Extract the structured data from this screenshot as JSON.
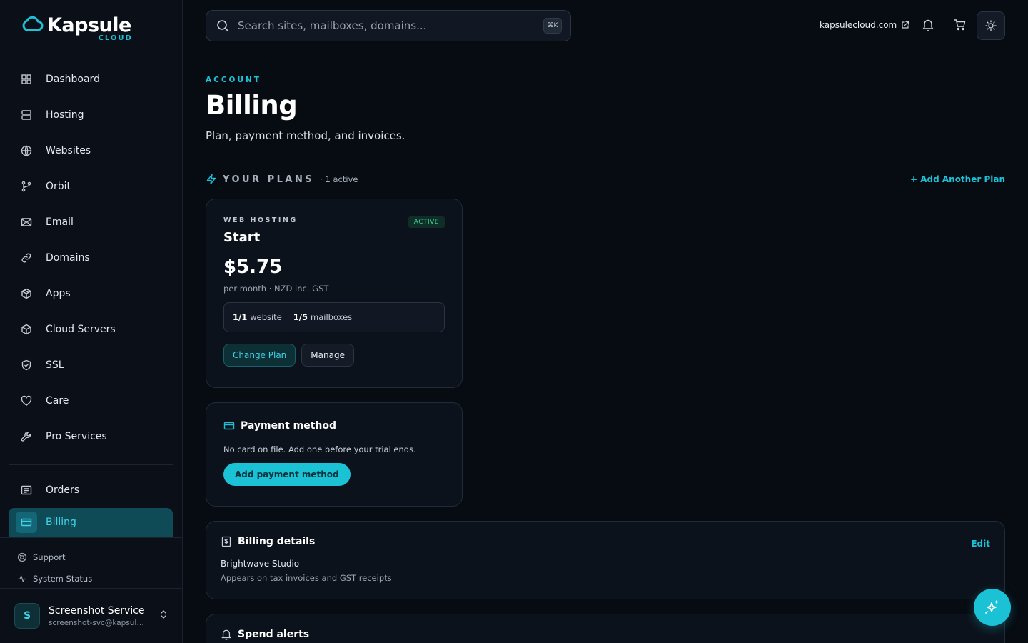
{
  "brand": {
    "name": "Kapsule",
    "sub": "CLOUD",
    "accent": "#1cc2d8"
  },
  "sidebar": {
    "items": [
      {
        "label": "Dashboard",
        "icon": "grid-icon"
      },
      {
        "label": "Hosting",
        "icon": "server-icon"
      },
      {
        "label": "Websites",
        "icon": "globe-icon"
      },
      {
        "label": "Orbit",
        "icon": "git-branch-icon"
      },
      {
        "label": "Email",
        "icon": "mail-icon"
      },
      {
        "label": "Domains",
        "icon": "link-icon"
      },
      {
        "label": "Apps",
        "icon": "package-icon"
      },
      {
        "label": "Cloud Servers",
        "icon": "cube-icon"
      },
      {
        "label": "SSL",
        "icon": "shield-icon"
      },
      {
        "label": "Care",
        "icon": "heart-icon"
      },
      {
        "label": "Pro Services",
        "icon": "wrench-icon"
      }
    ],
    "secondary": [
      {
        "label": "Orders",
        "icon": "receipt-icon"
      },
      {
        "label": "Billing",
        "icon": "credit-card-icon",
        "active": true
      }
    ],
    "footer_links": [
      {
        "label": "Support",
        "icon": "lifebuoy-icon"
      },
      {
        "label": "System Status",
        "icon": "activity-icon"
      }
    ],
    "user": {
      "initial": "S",
      "name": "Screenshot Service",
      "email": "screenshot-svc@kapsulecl..."
    }
  },
  "topbar": {
    "search_placeholder": "Search sites, mailboxes, domains...",
    "shortcut": "⌘K",
    "site_link": "kapsulecloud.com"
  },
  "page": {
    "eyebrow": "ACCOUNT",
    "title": "Billing",
    "subtitle": "Plan, payment method, and invoices."
  },
  "plans": {
    "heading": "YOUR PLANS",
    "count": "· 1 active",
    "add_label": "+ Add Another Plan",
    "items": [
      {
        "category": "WEB HOSTING",
        "status": "ACTIVE",
        "name": "Start",
        "price": "$5.75",
        "period": "per month · NZD inc. GST",
        "usage_websites_value": "1/1",
        "usage_websites_label": "website",
        "usage_mailboxes_value": "1/5",
        "usage_mailboxes_label": "mailboxes",
        "change_label": "Change Plan",
        "manage_label": "Manage"
      }
    ]
  },
  "payment": {
    "title": "Payment method",
    "note": "No card on file. Add one before your trial ends.",
    "button": "Add payment method"
  },
  "billing_details": {
    "title": "Billing details",
    "edit_label": "Edit",
    "company": "Brightwave Studio",
    "company_note": "Appears on tax invoices and GST receipts"
  },
  "spend_alerts": {
    "title": "Spend alerts"
  }
}
